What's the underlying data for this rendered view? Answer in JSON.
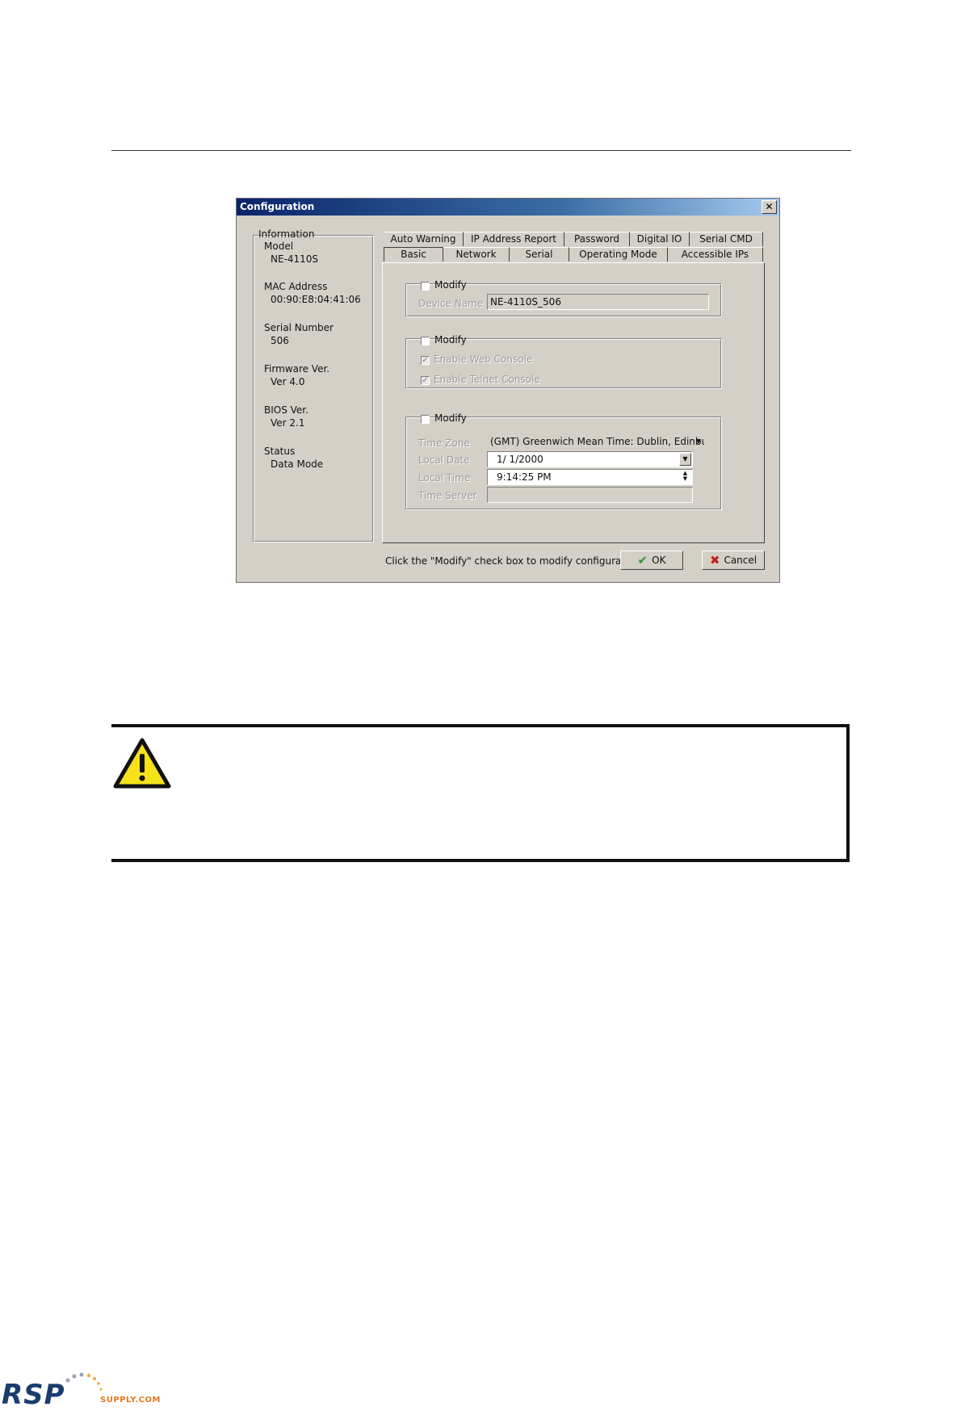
{
  "dialog": {
    "title": "Configuration",
    "close_label": "✕",
    "info": {
      "heading": "Information",
      "model_label": "Model",
      "model_value": "NE-4110S",
      "mac_label": "MAC Address",
      "mac_value": "00:90:E8:04:41:06",
      "serial_label": "Serial Number",
      "serial_value": "506",
      "firmware_label": "Firmware Ver.",
      "firmware_value": "Ver 4.0",
      "bios_label": "BIOS Ver.",
      "bios_value": "Ver 2.1",
      "status_label": "Status",
      "status_value": "Data Mode"
    },
    "tabs_top": [
      "Auto Warning",
      "IP Address Report",
      "Password",
      "Digital IO",
      "Serial CMD"
    ],
    "tabs_bottom": [
      "Basic",
      "Network",
      "Serial",
      "Operating Mode",
      "Accessible IPs"
    ],
    "active_tab": "Basic",
    "group1": {
      "modify_label": "Modify",
      "device_name_label": "Device Name",
      "device_name_value": "NE-4110S_506"
    },
    "group2": {
      "modify_label": "Modify",
      "web_console_label": "Enable Web Console",
      "telnet_console_label": "Enable Telnet Console"
    },
    "group3": {
      "modify_label": "Modify",
      "time_zone_label": "Time Zone",
      "time_zone_value": "(GMT) Greenwich Mean Time: Dublin, Edinbur",
      "local_date_label": "Local Date",
      "local_date_value": "1/  1/2000",
      "local_time_label": "Local Time",
      "local_time_value": "9:14:25 PM",
      "time_server_label": "Time Server",
      "time_server_value": ""
    },
    "hint": "Click the \"Modify\" check box to modify configuration",
    "ok_label": "OK",
    "cancel_label": "Cancel"
  },
  "logo": {
    "brand": "RSP",
    "sub": "SUPPLY.COM"
  },
  "colors": {
    "titlebar": "#0a246a",
    "face": "#d4d0c8",
    "ok_check": "#2e9a2e",
    "cancel_x": "#c0241c",
    "warning_fill": "#f5e21a"
  }
}
